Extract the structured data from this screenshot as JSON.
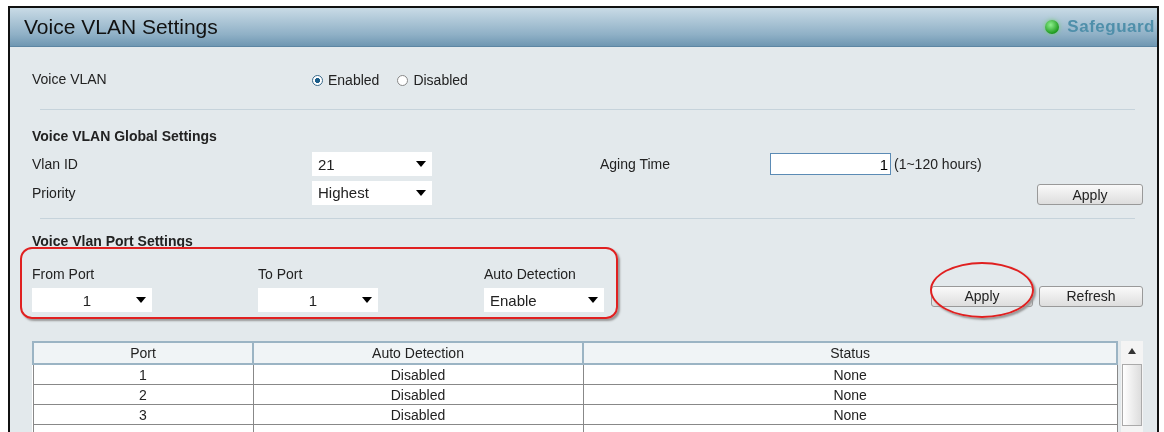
{
  "window": {
    "title": "Voice VLAN Settings",
    "safeguard": {
      "label": "Safeguard",
      "on": true
    }
  },
  "voice_vlan": {
    "label": "Voice VLAN",
    "options": [
      {
        "label": "Enabled",
        "selected": true
      },
      {
        "label": "Disabled",
        "selected": false
      }
    ]
  },
  "global_settings": {
    "heading": "Voice VLAN Global Settings",
    "vlan_id": {
      "label": "Vlan ID",
      "value": "21"
    },
    "aging_time": {
      "label": "Aging Time",
      "value": "1",
      "hint": "(1~120 hours)"
    },
    "priority": {
      "label": "Priority",
      "value": "Highest"
    },
    "apply": "Apply"
  },
  "port_settings": {
    "heading": "Voice Vlan Port Settings",
    "fields": [
      {
        "label": "From Port",
        "value": "1",
        "kind": "port"
      },
      {
        "label": "To Port",
        "value": "1",
        "kind": "port"
      },
      {
        "label": "Auto Detection",
        "value": "Enable",
        "kind": "mode"
      }
    ],
    "buttons": [
      "Apply",
      "Refresh"
    ]
  },
  "table": {
    "columns": [
      "Port",
      "Auto Detection",
      "Status"
    ],
    "rows": [
      [
        "1",
        "Disabled",
        "None"
      ],
      [
        "2",
        "Disabled",
        "None"
      ],
      [
        "3",
        "Disabled",
        "None"
      ]
    ]
  }
}
